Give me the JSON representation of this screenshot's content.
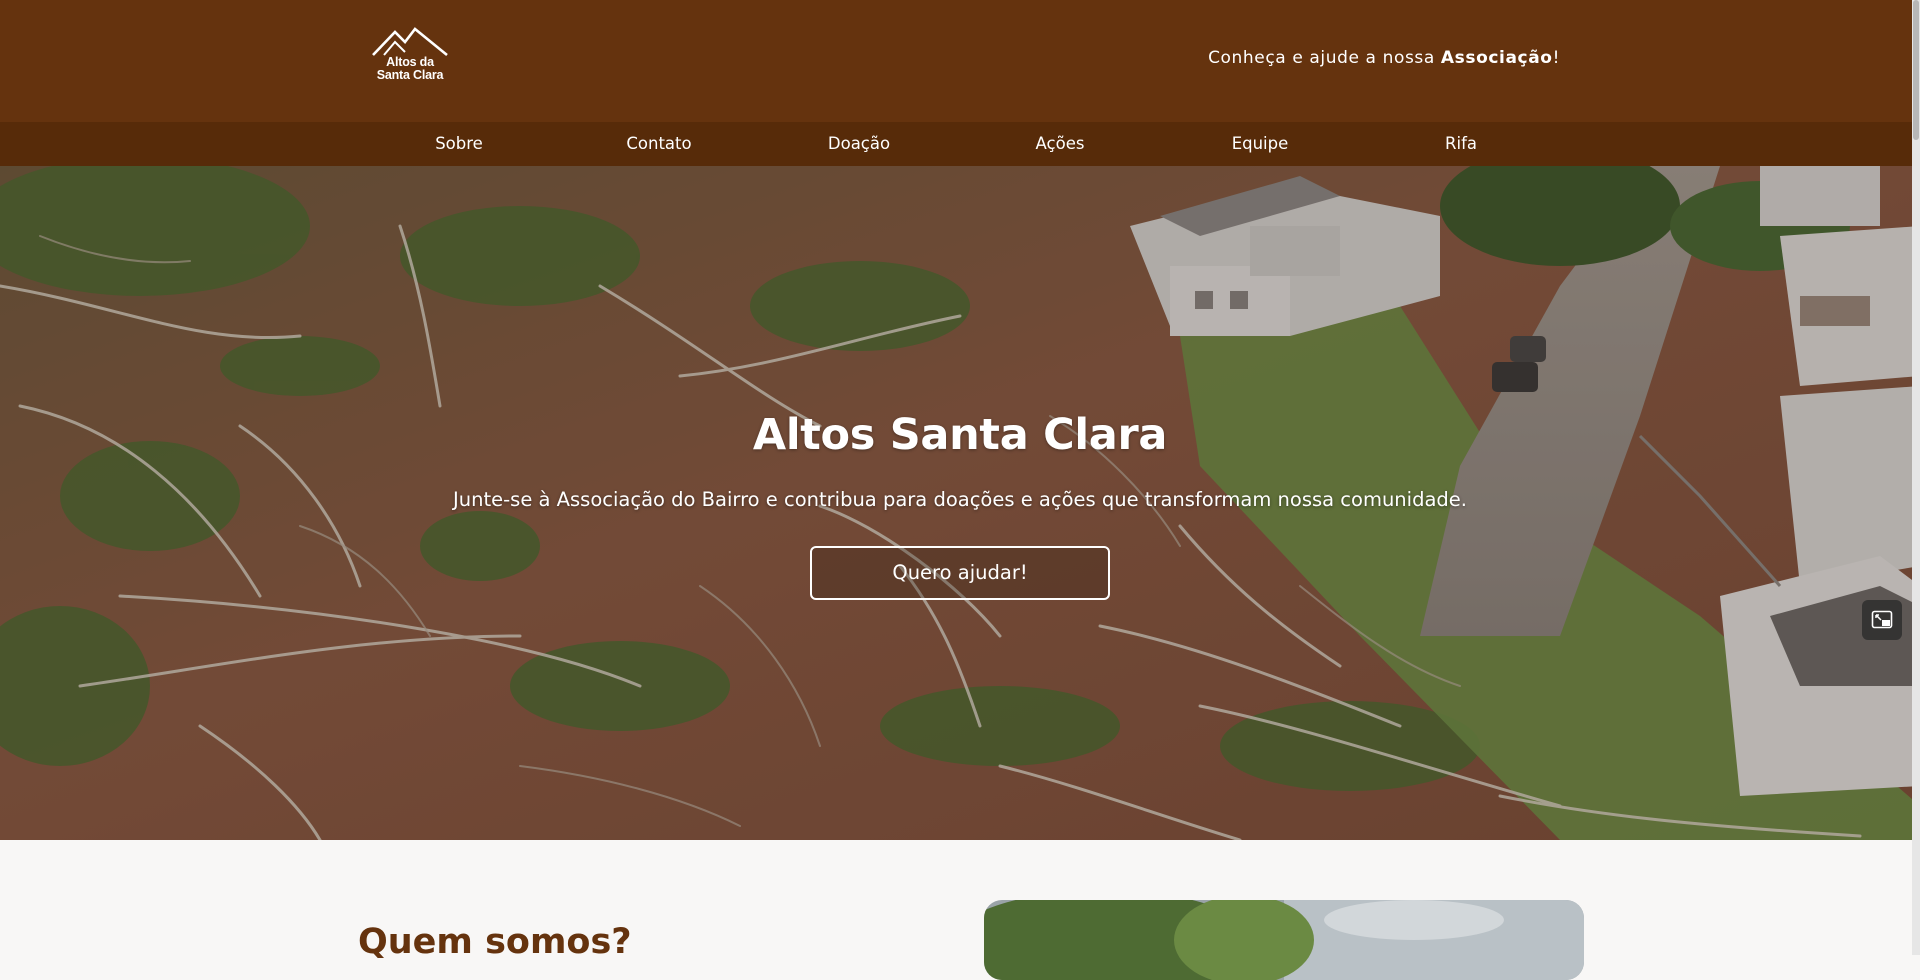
{
  "header": {
    "logo": {
      "line1": "Altos da",
      "line2": "Santa Clara",
      "icon": "mountain-icon"
    },
    "tagline": {
      "prefix": "Conheça e ajude a nossa ",
      "bold": "Associação",
      "suffix": "!"
    }
  },
  "nav": {
    "items": [
      {
        "label": "Sobre"
      },
      {
        "label": "Contato"
      },
      {
        "label": "Doação"
      },
      {
        "label": "Ações"
      },
      {
        "label": "Equipe"
      },
      {
        "label": "Rifa"
      }
    ]
  },
  "hero": {
    "title": "Altos Santa Clara",
    "subtitle": "Junte-se à Associação do Bairro e contribua para doações e ações que transformam nossa comunidade.",
    "cta": "Quero ajudar!",
    "expand_icon": "expand-image-icon"
  },
  "about": {
    "title": "Quem somos?"
  },
  "colors": {
    "brand_brown": "#65330e",
    "nav_brown": "#572b09",
    "text_light": "#ffffff"
  }
}
